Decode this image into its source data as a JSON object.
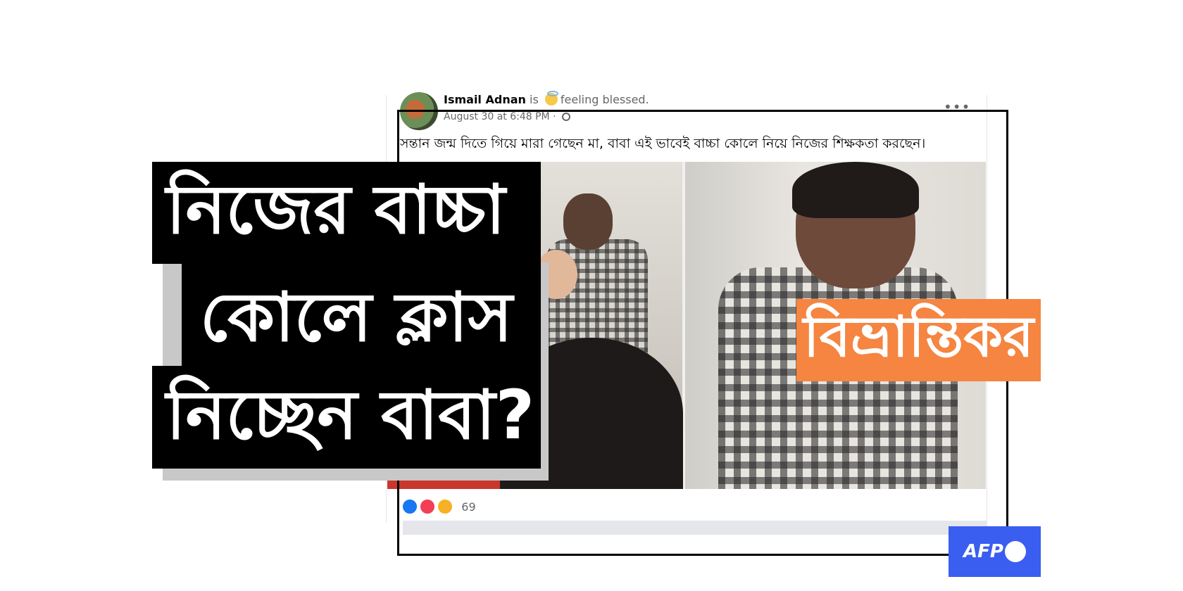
{
  "post": {
    "author_name": "Ismail Adnan",
    "author_is": "is",
    "feeling": "feeling blessed.",
    "timestamp": "August 30 at 6:48 PM ·",
    "text": "সন্তান জন্ম দিতে গিয়ে মারা গেছেন মা, বাবা এই ভাবেই বাচ্চা কোলে নিয়ে নিজের শিক্ষকতা করছেন।",
    "more_label": "•••",
    "reaction_count": "69"
  },
  "headline": {
    "line1": "নিজের বাচ্চা",
    "line2": "কোলে ক্লাস",
    "line3": "নিচ্ছেন বাবা?"
  },
  "verdict": "বিভ্রান্তিকর",
  "logo": {
    "text": "AFP"
  },
  "colors": {
    "verdict_bg": "#f58540",
    "logo_bg": "#3a5ef0",
    "headline_bg": "#000000",
    "facebook_blue": "#1877f2"
  },
  "icons": [
    "avatar",
    "feeling-emoji-icon",
    "globe-icon",
    "more-icon",
    "like-icon",
    "love-icon",
    "sad-icon"
  ]
}
